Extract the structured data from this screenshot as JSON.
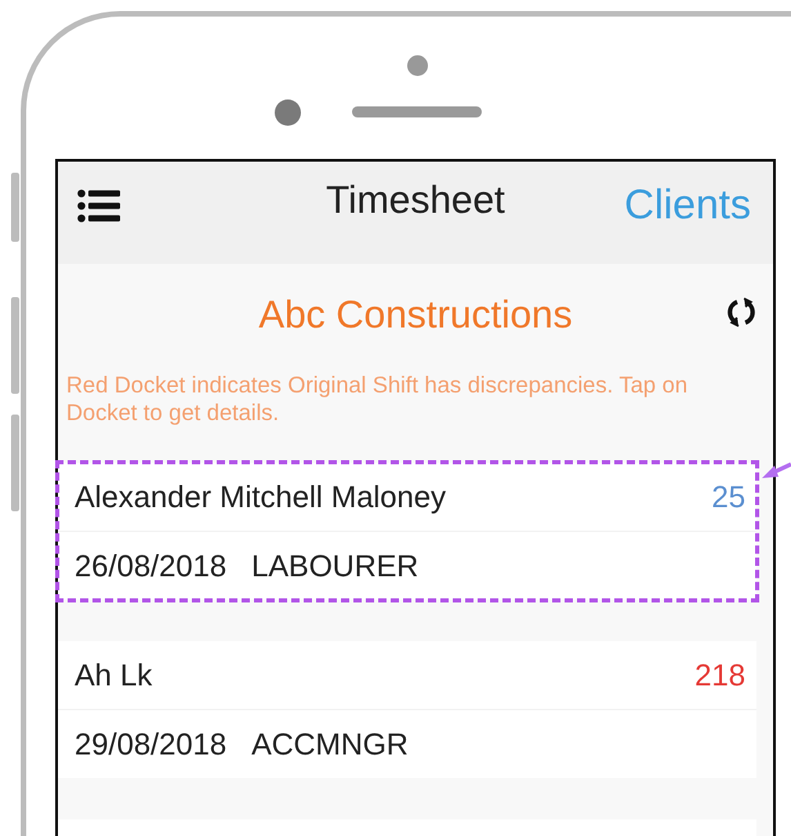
{
  "nav_bar": {
    "title": "Timesheet",
    "action": "Clients"
  },
  "client": {
    "name": "Abc Constructions"
  },
  "notice": "Red Docket indicates Original Shift has discrepancies. Tap on Docket to get details.",
  "dockets": [
    {
      "name": "Alexander Mitchell Maloney",
      "count": "25",
      "color": "#5b8fd0",
      "date": "26/08/2018",
      "role": "LABOURER",
      "highlighted": true
    },
    {
      "name": "Ah Lk",
      "count": "218",
      "color": "#e53935",
      "date": "29/08/2018",
      "role": "ACCMNGR",
      "highlighted": false
    }
  ]
}
